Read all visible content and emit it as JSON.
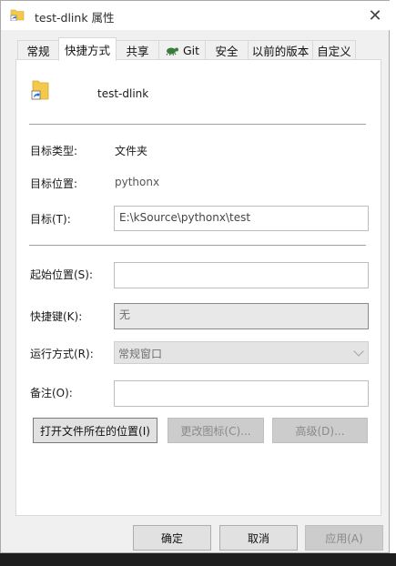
{
  "window": {
    "title": "test-dlink 属性",
    "close_glyph": "✕"
  },
  "tabs": [
    {
      "label": "常规"
    },
    {
      "label": "快捷方式"
    },
    {
      "label": "共享"
    },
    {
      "label": "Git"
    },
    {
      "label": "安全"
    },
    {
      "label": "以前的版本"
    },
    {
      "label": "自定义"
    }
  ],
  "active_tab": "快捷方式",
  "header": {
    "name": "test-dlink",
    "icon": "folder-shortcut-icon"
  },
  "info": {
    "target_type_label": "目标类型:",
    "target_type_value": "文件夹",
    "target_location_label": "目标位置:",
    "target_location_value": "pythonx",
    "target_label": "目标(T):",
    "target_value": "E:\\kSource\\pythonx\\test"
  },
  "options": {
    "start_in_label": "起始位置(S):",
    "start_in_value": "",
    "hotkey_label": "快捷键(K):",
    "hotkey_value": "无",
    "run_label": "运行方式(R):",
    "run_value": "常规窗口",
    "comment_label": "备注(O):",
    "comment_value": ""
  },
  "action_buttons": {
    "open_location": "打开文件所在的位置(I)",
    "change_icon": "更改图标(C)...",
    "advanced": "高级(D)..."
  },
  "footer": {
    "ok": "确定",
    "cancel": "取消",
    "apply": "应用(A)"
  },
  "colors": {
    "folder_yellow": "#f2c94c",
    "shortcut_arrow_blue": "#1a73d6",
    "panel_bg": "#ffffff",
    "dialog_bg": "#f0f0f0"
  }
}
